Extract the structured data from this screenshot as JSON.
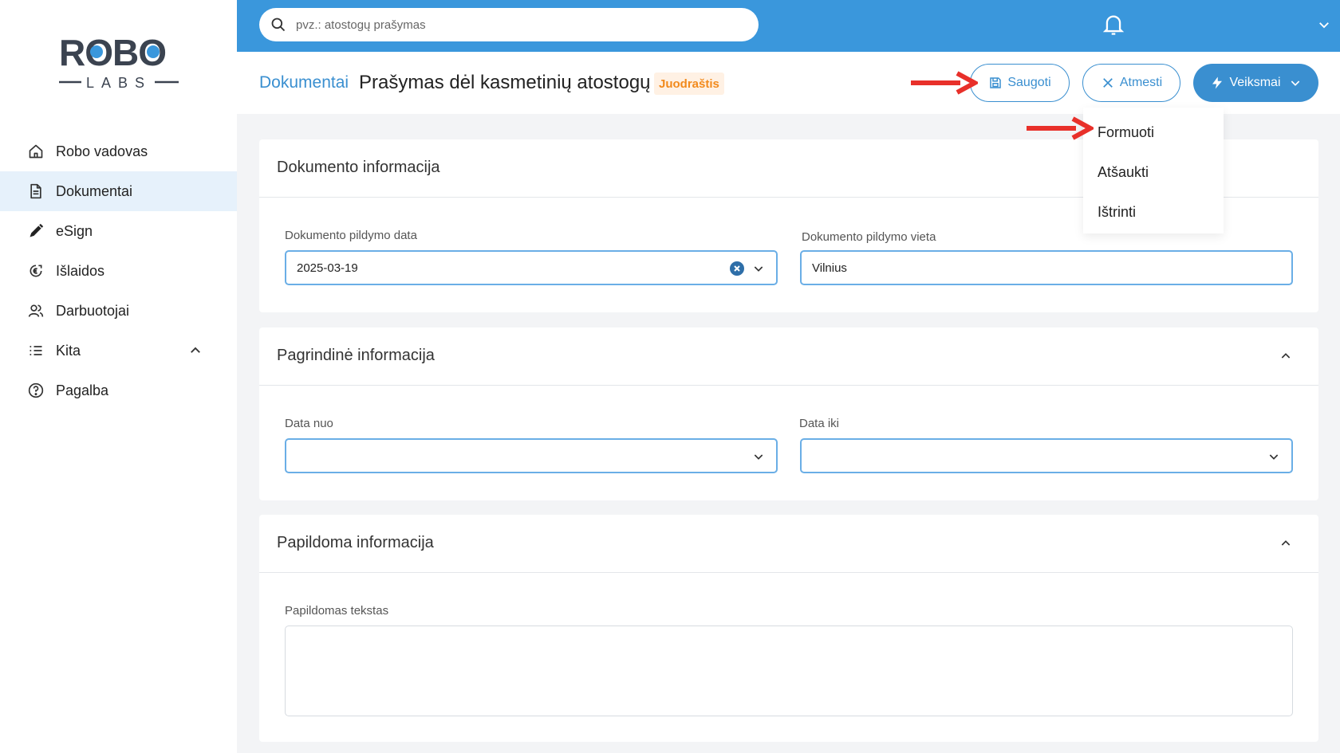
{
  "sidebar": {
    "logo_top": "ROBO",
    "logo_bottom": "LABS",
    "items": [
      {
        "label": "Robo vadovas",
        "icon": "home-icon"
      },
      {
        "label": "Dokumentai",
        "icon": "document-icon",
        "active": true
      },
      {
        "label": "eSign",
        "icon": "pen-icon"
      },
      {
        "label": "Išlaidos",
        "icon": "coin-icon"
      },
      {
        "label": "Darbuotojai",
        "icon": "users-icon"
      },
      {
        "label": "Kita",
        "icon": "list-icon"
      },
      {
        "label": "Pagalba",
        "icon": "help-icon"
      }
    ]
  },
  "topbar": {
    "search_placeholder": "pvz.: atostogų prašymas"
  },
  "header": {
    "breadcrumb": "Dokumentai",
    "title": "Prašymas dėl kasmetinių atostogų",
    "badge": "Juodraštis",
    "save_label": "Saugoti",
    "reject_label": "Atmesti",
    "actions_label": "Veiksmai"
  },
  "actions_menu": {
    "items": [
      "Formuoti",
      "Atšaukti",
      "Ištrinti"
    ]
  },
  "sections": {
    "doc_info": {
      "title": "Dokumento informacija",
      "date_label": "Dokumento pildymo data",
      "date_value": "2025-03-19",
      "place_label": "Dokumento pildymo vieta",
      "place_value": "Vilnius"
    },
    "main_info": {
      "title": "Pagrindinė informacija",
      "from_label": "Data nuo",
      "to_label": "Data iki"
    },
    "extra_info": {
      "title": "Papildoma informacija",
      "text_label": "Papildomas tekstas"
    }
  },
  "colors": {
    "primary": "#3a8fd0",
    "topbar": "#3a97dc",
    "badge_text": "#f28a1c",
    "arrow": "#e8302a"
  }
}
